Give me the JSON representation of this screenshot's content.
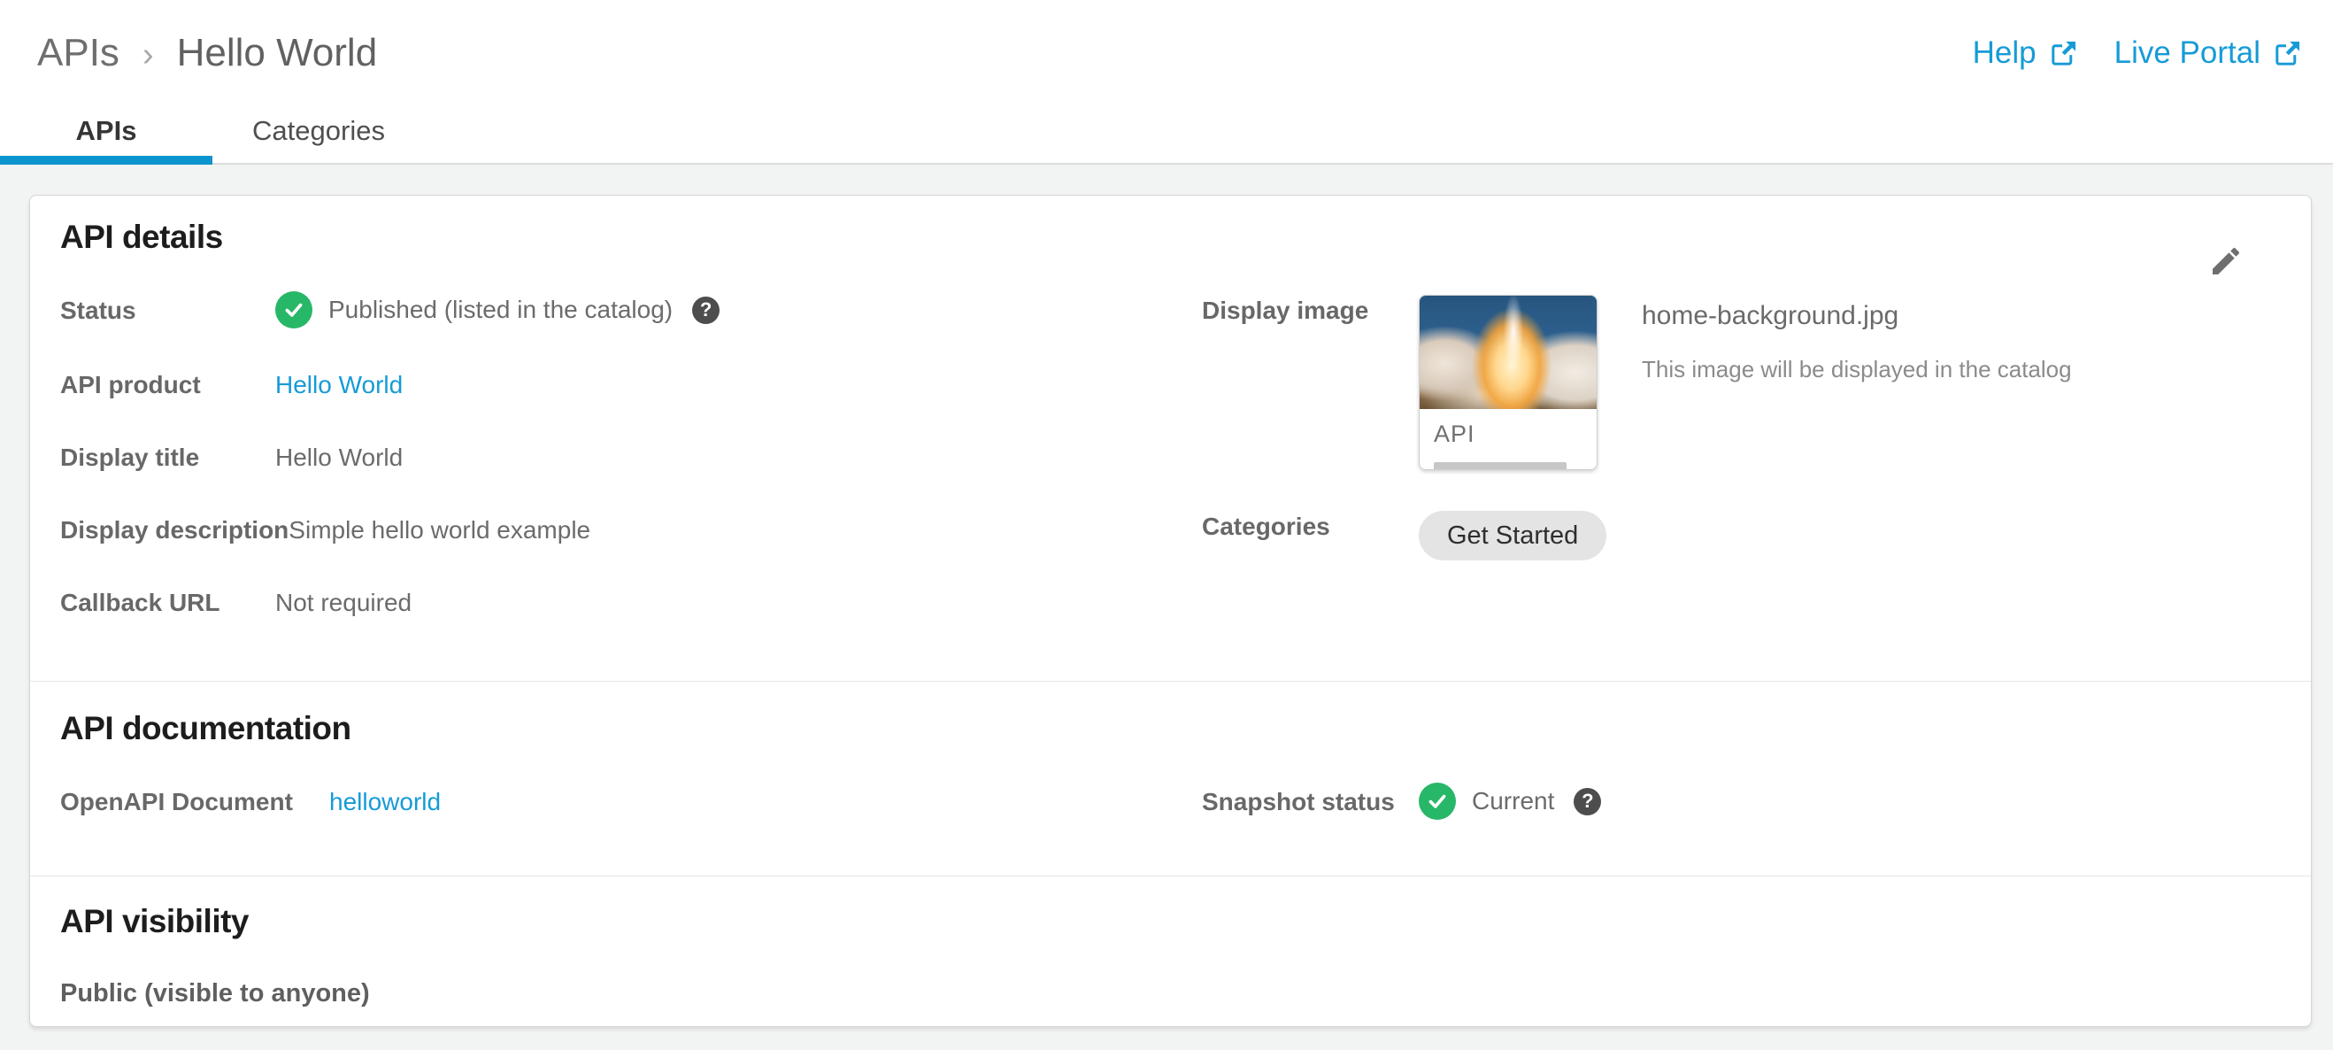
{
  "colors": {
    "accent_blue": "#0d93ce",
    "link_blue": "#169bd7",
    "status_green": "#27b768",
    "page_bg": "#f2f3f3"
  },
  "icons": {
    "help_glyph": "?",
    "breadcrumb_separator": "›"
  },
  "breadcrumb": {
    "root": "APIs",
    "current": "Hello World"
  },
  "header_links": {
    "help": "Help",
    "live_portal": "Live Portal"
  },
  "tabs": {
    "apis": "APIs",
    "categories": "Categories"
  },
  "sections": {
    "details": {
      "title": "API details",
      "status": {
        "label": "Status",
        "value": "Published (listed in the catalog)"
      },
      "api_product": {
        "label": "API product",
        "value": "Hello World"
      },
      "display_title": {
        "label": "Display title",
        "value": "Hello World"
      },
      "display_description": {
        "label": "Display description",
        "value": "Simple hello world example"
      },
      "callback_url": {
        "label": "Callback URL",
        "value": "Not required"
      },
      "display_image": {
        "label": "Display image",
        "thumb_caption": "API",
        "filename": "home-background.jpg",
        "note": "This image will be displayed in the catalog"
      },
      "categories": {
        "label": "Categories",
        "tags": [
          "Get Started"
        ]
      }
    },
    "documentation": {
      "title": "API documentation",
      "openapi": {
        "label": "OpenAPI Document",
        "value": "helloworld"
      },
      "snapshot": {
        "label": "Snapshot status",
        "value": "Current"
      }
    },
    "visibility": {
      "title": "API visibility",
      "value": "Public (visible to anyone)"
    }
  }
}
